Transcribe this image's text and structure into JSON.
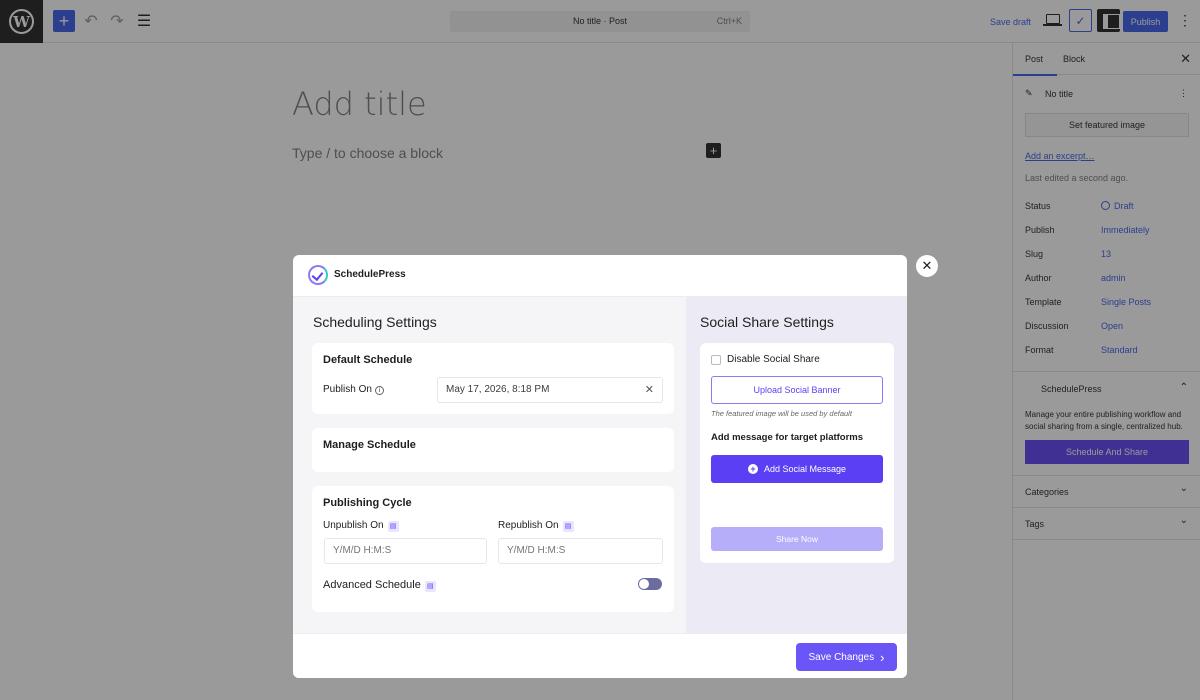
{
  "topbar": {
    "logo": "W",
    "add_icon": "+",
    "undo_icon": "↶",
    "redo_icon": "↷",
    "list_icon": "☰",
    "command_title": "No title · Post",
    "command_shortcut": "Ctrl+K",
    "save_draft": "Save draft",
    "publish": "Publish",
    "sp_icon": "✓",
    "more_icon": "⋮"
  },
  "editor": {
    "title_placeholder": "Add title",
    "block_placeholder": "Type / to choose a block",
    "block_add_icon": "+"
  },
  "sidebar": {
    "tab_post": "Post",
    "tab_block": "Block",
    "close_icon": "✕",
    "post_title": "No title",
    "post_icon": "✎",
    "more_icon": "⋮",
    "featured_image": "Set featured image",
    "excerpt_link": "Add an excerpt…",
    "last_edited": "Last edited a second ago.",
    "rows": [
      {
        "label": "Status",
        "value": "Draft"
      },
      {
        "label": "Publish",
        "value": "Immediately"
      },
      {
        "label": "Slug",
        "value": "13"
      },
      {
        "label": "Author",
        "value": "admin"
      },
      {
        "label": "Template",
        "value": "Single Posts"
      },
      {
        "label": "Discussion",
        "value": "Open"
      },
      {
        "label": "Format",
        "value": "Standard"
      }
    ],
    "sp_title": "SchedulePress",
    "sp_desc_1": "Manage your entire publishing workflow and",
    "sp_desc_2": "social sharing from a single, centralized hub.",
    "sp_button": "Schedule And Share",
    "categories": "Categories",
    "tags": "Tags",
    "chevron_up": "⌃",
    "chevron_down": "⌄"
  },
  "modal": {
    "close_icon": "✕",
    "brand": "SchedulePress",
    "scheduling": {
      "title": "Scheduling Settings",
      "default_schedule": {
        "title": "Default Schedule",
        "publish_on_label": "Publish On",
        "publish_on_value": "May 17, 2026, 8:18 PM",
        "clear_icon": "✕",
        "info_icon": "i"
      },
      "manage_schedule": {
        "title": "Manage Schedule"
      },
      "publishing_cycle": {
        "title": "Publishing Cycle",
        "unpublish_label": "Unpublish On",
        "republish_label": "Republish On",
        "unpublish_placeholder": "Y/M/D H:M:S",
        "republish_placeholder": "Y/M/D H:M:S",
        "doc_icon": "▤",
        "advanced_label": "Advanced Schedule",
        "advanced_enabled": false
      }
    },
    "social": {
      "title": "Social Share Settings",
      "disable_label": "Disable Social Share",
      "disable_checked": false,
      "upload_banner": "Upload Social Banner",
      "hint": "The featured image will be used by default",
      "message_label": "Add message for target platforms",
      "add_message": "Add Social Message",
      "plus_icon": "+",
      "share_now": "Share Now"
    },
    "footer": {
      "save_changes": "Save Changes",
      "chevron_icon": "›"
    }
  }
}
